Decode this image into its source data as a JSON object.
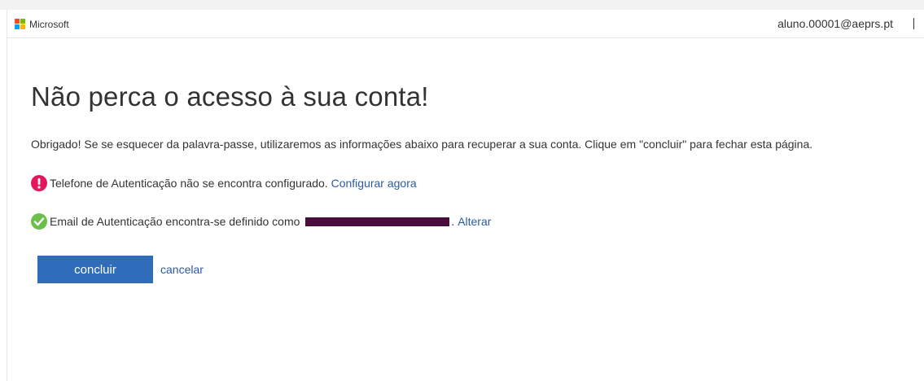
{
  "brand": {
    "name": "Microsoft",
    "logo_colors": [
      "#f25022",
      "#7fba00",
      "#00a4ef",
      "#ffb900"
    ]
  },
  "header": {
    "user_email": "aluno.00001@aeprs.pt"
  },
  "main": {
    "title": "Não perca o acesso à sua conta!",
    "description": "Obrigado! Se se esquecer da palavra-passe, utilizaremos as informações abaixo para recuperar a sua conta. Clique em \"concluir\" para fechar esta página.",
    "phone": {
      "icon": "exclamation-icon",
      "text": "Telefone de Autenticação não se encontra configurado.",
      "link_label": "Configurar agora"
    },
    "email": {
      "icon": "checkmark-icon",
      "text": "Email de Autenticação encontra-se definido como",
      "link_label": "Alterar"
    },
    "actions": {
      "primary_label": "concluir",
      "cancel_label": "cancelar"
    }
  },
  "colors": {
    "accent": "#2f6dbb",
    "link": "#2a5aa6",
    "warning": "#e2185b",
    "success": "#6cc04a",
    "redaction": "#4a0e3e"
  }
}
